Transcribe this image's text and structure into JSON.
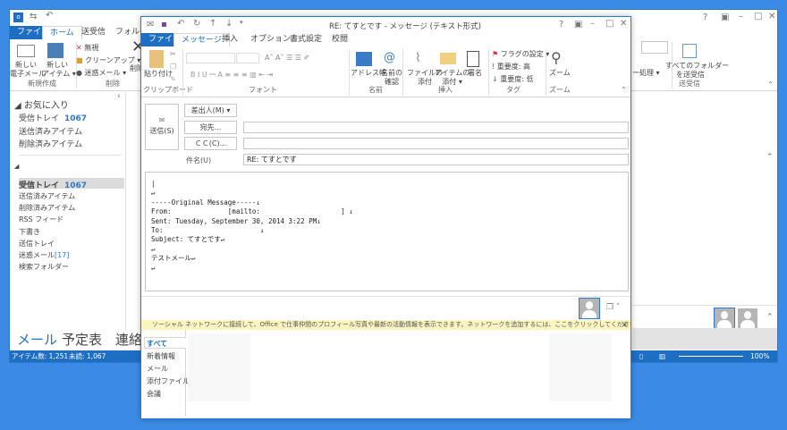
{
  "main": {
    "tabs": [
      "ファイル",
      "ホーム",
      "送受信",
      "フォルダー"
    ],
    "ribbon": {
      "new_email": "新しい\n電子メール",
      "new_item": "新しい\nアイテム ▾",
      "group_new": "新規作成",
      "ignore": "無視",
      "cleanup": "クリーンアップ ▾",
      "junk": "迷惑メール ▾",
      "group_delete": "削除",
      "delete": "削除",
      "rules": "ー処理 ▾",
      "send_all": "すべてのフォルダー\nを送受信",
      "group_sendrecv": "送受信"
    },
    "favorites_header": "お気に入り",
    "favorites": [
      {
        "label": "受信トレイ",
        "count": "1067"
      },
      {
        "label": "送信済みアイテム"
      },
      {
        "label": "削除済みアイテム"
      }
    ],
    "folders": [
      {
        "label": "受信トレイ",
        "count": "1067"
      },
      {
        "label": "送信済みアイテム"
      },
      {
        "label": "削除済みアイテム"
      },
      {
        "label": "RSS フィード"
      },
      {
        "label": "下書き"
      },
      {
        "label": "送信トレイ"
      },
      {
        "label": "迷惑メール",
        "count": "[17]"
      },
      {
        "label": "検索フォルダー"
      }
    ],
    "nav": [
      "メール",
      "予定表",
      "連絡"
    ],
    "status": {
      "items": "アイテム数: 1,251",
      "unread": "未読: 1,067",
      "zoom": "100%"
    }
  },
  "compose": {
    "title": "RE: てすとです - メッセージ (テキスト形式)",
    "tabs": [
      "ファイル",
      "メッセージ",
      "挿入",
      "オプション",
      "書式設定",
      "校閲"
    ],
    "ribbon": {
      "paste": "貼り付け",
      "group_clipboard": "クリップボード",
      "group_font": "フォント",
      "address_book": "アドレス帳",
      "check_names": "名前の\n確認",
      "group_names": "名前",
      "attach_file": "ファイルの\n添付",
      "attach_item": "アイテムの\n添付 ▾",
      "signature": "署名",
      "group_insert": "挿入",
      "flag": "フラグの設定 ▾",
      "high": "重要度: 高",
      "low": "重要度: 低",
      "group_tags": "タグ",
      "zoom": "ズーム",
      "group_zoom": "ズーム"
    },
    "send": "送信(S)",
    "from_btn": "差出人(M) ▾",
    "to_btn": "宛先...",
    "cc_btn": "ＣＣ(C)...",
    "subject_label": "件名(U)",
    "to_value": "",
    "cc_value": "",
    "subject_value": "RE: てすとです",
    "body_lines": [
      "↵",
      "-----Original Message-----↓",
      "From:              [mailto:                    ] ↓",
      "Sent: Tuesday, September 30, 2014 3:22 PM↓",
      "To:                        ↓",
      "Subject: てすとです↵",
      "↵",
      "テストメール↵",
      "↵"
    ],
    "infobar": "ソーシャル ネットワークに接続して、Office で仕事仲間のプロフィール写真や最新の活動情報を表示できます。ネットワークを追加するには、ここをクリックしてください。",
    "people_tabs": [
      "すべて",
      "新着情報",
      "メール",
      "添付ファイル",
      "会議"
    ]
  },
  "colors": {
    "accent": "#1e6fc4",
    "infobar": "#fcf5c0",
    "desktop": "#3b8be6"
  }
}
